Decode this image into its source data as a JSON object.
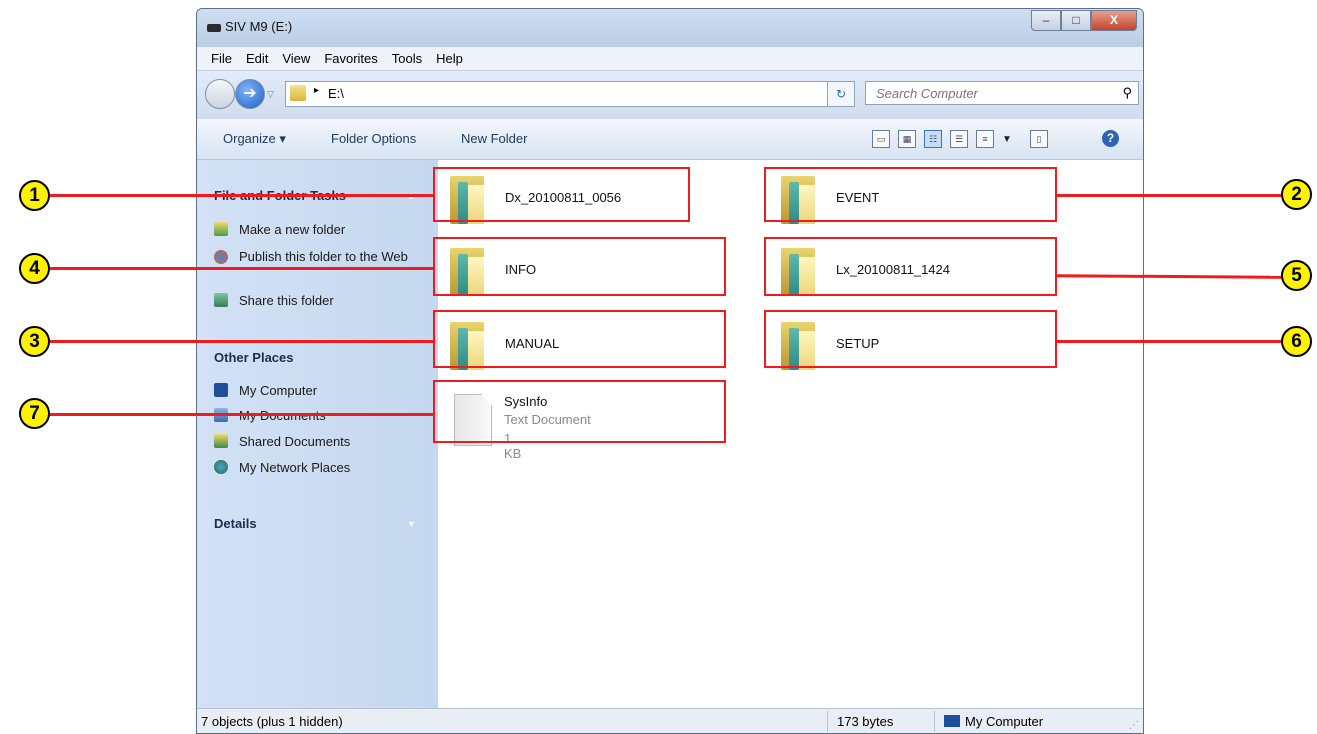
{
  "window": {
    "title": "SIV M9 (E:)",
    "buttons": {
      "minimize": "–",
      "maximize": "□",
      "close": "X"
    }
  },
  "menu": [
    "File",
    "Edit",
    "View",
    "Favorites",
    "Tools",
    "Help"
  ],
  "address": {
    "path": "E:\\",
    "arrow": "▸"
  },
  "search": {
    "placeholder": "Search Computer"
  },
  "toolbar": {
    "organize": "Organize ▾",
    "folder_options": "Folder Options",
    "new_folder": "New Folder"
  },
  "sidebar": {
    "tasks_title": "File and Folder Tasks",
    "tasks": [
      {
        "label": "Make a new folder",
        "icon": "new-folder-icon"
      },
      {
        "label": "Publish this folder to the Web",
        "icon": "globe-icon"
      },
      {
        "label": "Share this folder",
        "icon": "share-icon"
      }
    ],
    "other_title": "Other Places",
    "places": [
      {
        "label": "My Computer",
        "icon": "computer-icon"
      },
      {
        "label": "My Documents",
        "icon": "documents-icon"
      },
      {
        "label": "Shared Documents",
        "icon": "shared-documents-icon"
      },
      {
        "label": "My Network Places",
        "icon": "network-icon"
      }
    ],
    "details_title": "Details"
  },
  "files": [
    {
      "name": "Dx_20100811_0056",
      "type": "folder"
    },
    {
      "name": "EVENT",
      "type": "folder"
    },
    {
      "name": "INFO",
      "type": "folder"
    },
    {
      "name": "Lx_20100811_1424",
      "type": "folder"
    },
    {
      "name": "MANUAL",
      "type": "folder"
    },
    {
      "name": "SETUP",
      "type": "folder"
    },
    {
      "name": "SysInfo",
      "type": "Text Document",
      "size": "1 KB"
    }
  ],
  "status": {
    "objects": "7 objects (plus 1 hidden)",
    "bytes": "173 bytes",
    "location": "My Computer"
  },
  "callouts": [
    "1",
    "2",
    "4",
    "5",
    "3",
    "6",
    "7"
  ],
  "colors": {
    "highlight": "#ee1c1c",
    "callout_fill": "#fff200"
  }
}
